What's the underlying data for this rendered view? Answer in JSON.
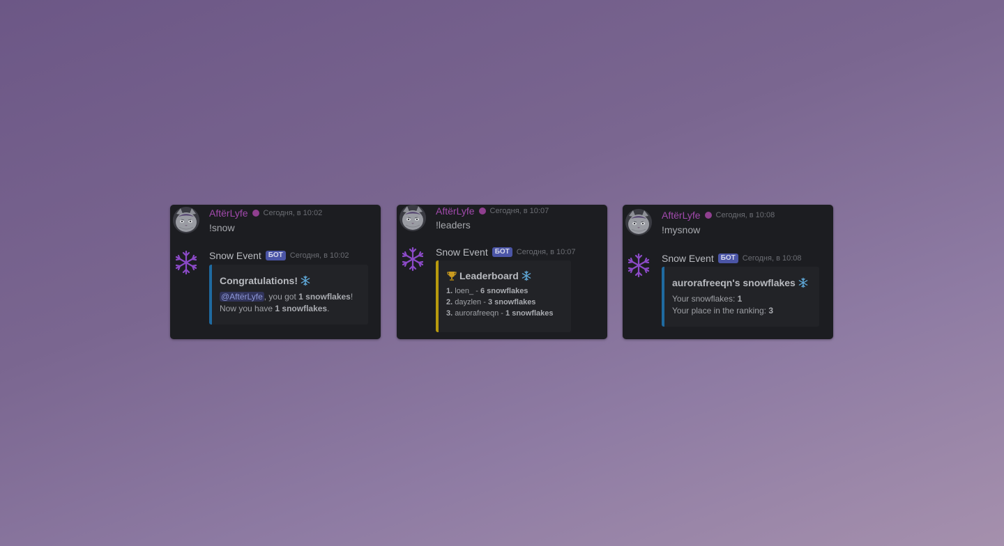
{
  "colors": {
    "user_name": "#a24aad",
    "bot_name": "#b9bbc0",
    "badge": "#4b55a6",
    "embed_blue": "#1f6aa0",
    "embed_gold": "#b89a0e",
    "card_bg": "#1c1d21"
  },
  "cards": [
    {
      "user": {
        "name": "AftërLyfe",
        "time": "Сегодня, в 10:02",
        "command": "!snow"
      },
      "bot": {
        "name": "Snow Event",
        "badge": "БОТ",
        "time": "Сегодня, в 10:02"
      },
      "embed": {
        "title": "Congratulations!",
        "mention": "@AftërLyfe",
        "line1_mid": ", you got ",
        "line1_bold": "1 snowflakes",
        "line1_end": "!",
        "line2_pre": "Now you have ",
        "line2_bold": "1 snowflakes",
        "line2_end": "."
      }
    },
    {
      "user": {
        "name": "AftërLyfe",
        "time": "Сегодня, в 10:07",
        "command": "!leaders"
      },
      "bot": {
        "name": "Snow Event",
        "badge": "БОТ",
        "time": "Сегодня, в 10:07"
      },
      "embed": {
        "title": "Leaderboard",
        "rows": [
          {
            "rank": "1.",
            "name": "loen_",
            "sep": " - ",
            "score": "6 snowflakes"
          },
          {
            "rank": "2.",
            "name": "dayzlen",
            "sep": " - ",
            "score": "3 snowflakes"
          },
          {
            "rank": "3.",
            "name": "aurorafreeqn",
            "sep": " - ",
            "score": "1 snowflakes"
          }
        ]
      }
    },
    {
      "user": {
        "name": "AftërLyfe",
        "time": "Сегодня, в 10:08",
        "command": "!mysnow"
      },
      "bot": {
        "name": "Snow Event",
        "badge": "БОТ",
        "time": "Сегодня, в 10:08"
      },
      "embed": {
        "title": "aurorafreeqn's snowflakes",
        "line1_label": "Your snowflakes: ",
        "line1_value": "1",
        "line2_label": "Your place in the ranking: ",
        "line2_value": "3"
      }
    }
  ],
  "icons": {
    "user_avatar": "cat-avatar-icon",
    "bot_avatar": "snowflake-icon",
    "trophy": "trophy-icon",
    "status": "status-dot-icon"
  }
}
